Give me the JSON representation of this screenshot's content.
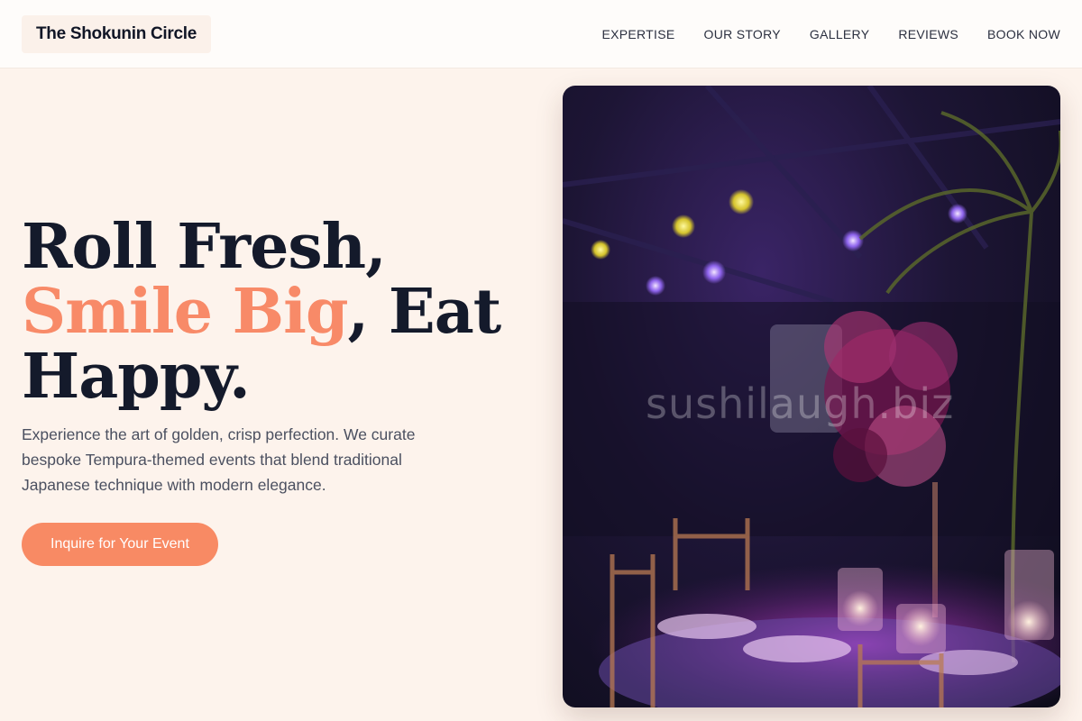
{
  "header": {
    "brand": "The Shokunin Circle",
    "nav": [
      "EXPERTISE",
      "OUR STORY",
      "GALLERY",
      "REVIEWS",
      "BOOK NOW"
    ]
  },
  "hero": {
    "headline_line1": "Roll Fresh,",
    "headline_accent": "Smile Big",
    "headline_after_accent": ", Eat",
    "headline_line3": "Happy.",
    "description": "Experience the art of golden, crisp perfection. We curate bespoke Tempura-themed events that blend traditional Japanese technique with modern elegance.",
    "cta_label": "Inquire for Your Event"
  },
  "photo": {
    "watermark": "sushilaugh.biz"
  },
  "colors": {
    "accent": "#f88a68",
    "background": "#fdf3ec",
    "text": "#141a2b"
  }
}
